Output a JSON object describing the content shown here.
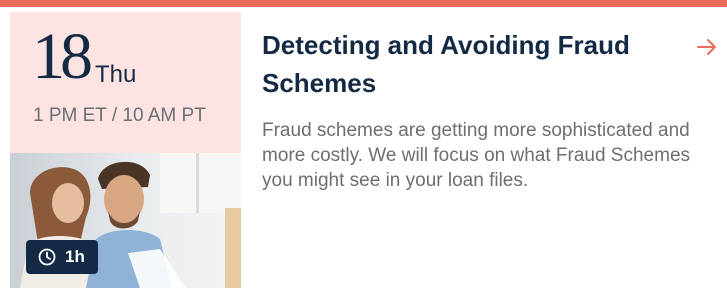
{
  "event": {
    "day": "18",
    "weekday": "Thu",
    "time": "1 PM ET / 10 AM PT",
    "title": "Detecting and Avoiding Fraud Schemes",
    "description": "Fraud schemes are getting more sophisticated and more costly. We will focus on what Fraud Schemes you might see in your loan files.",
    "duration": "1h"
  },
  "icons": {
    "duration": "clock-icon",
    "open": "arrow-right-icon"
  },
  "colors": {
    "accent": "#ec6b5f",
    "date_panel": "#fde3e2",
    "navy": "#142a44",
    "muted_text": "#6b6e73"
  }
}
